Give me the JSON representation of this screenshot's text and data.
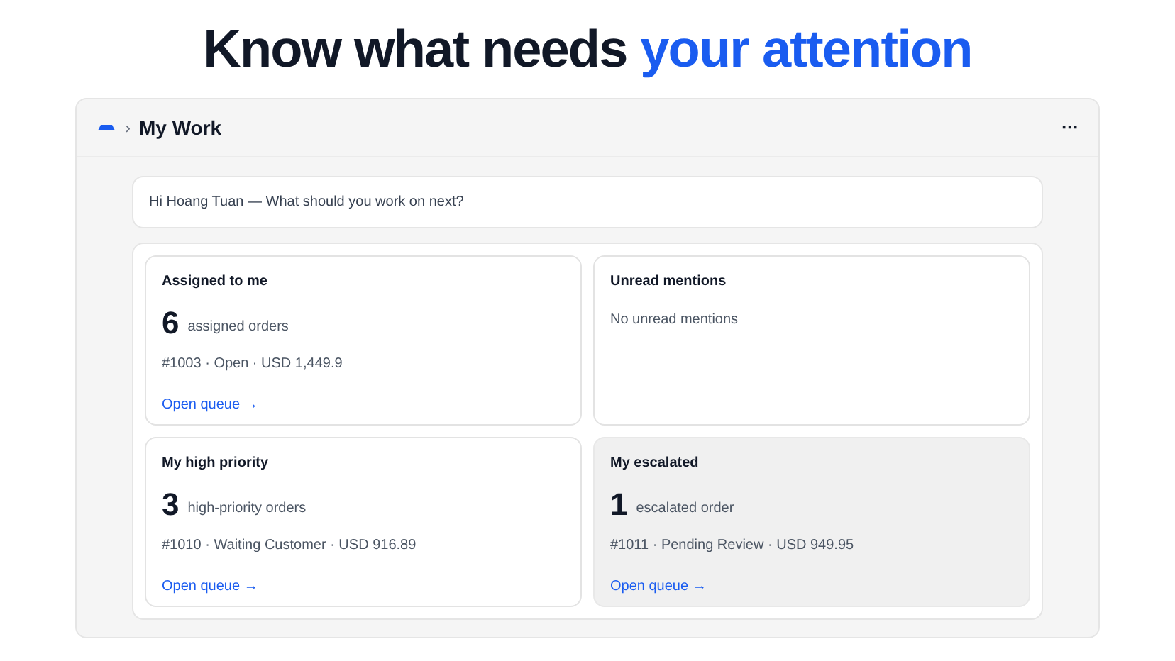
{
  "headline": {
    "text": "Know what needs",
    "accent": "your attention"
  },
  "window": {
    "breadcrumb_separator": "›",
    "title": "My Work",
    "menu": "···"
  },
  "greeting": "Hi Hoang Tuan — What should you work on next?",
  "cards": [
    {
      "kind": "count",
      "title": "Assigned to me",
      "count": "6",
      "count_label": "assigned orders",
      "detail": "#1003 · Open · USD 1,449.9",
      "link": "Open queue →",
      "highlighted": false
    },
    {
      "kind": "empty",
      "title": "Unread mentions",
      "message": "No unread mentions",
      "highlighted": false
    },
    {
      "kind": "count",
      "title": "My high priority",
      "count": "3",
      "count_label": "high-priority orders",
      "detail": "#1010 · Waiting Customer · USD 916.89",
      "link": "Open queue →",
      "highlighted": false
    },
    {
      "kind": "count",
      "title": "My escalated",
      "count": "1",
      "count_label": "escalated order",
      "detail": "#1011 · Pending Review · USD 949.95",
      "link": "Open queue →",
      "highlighted": true
    }
  ]
}
